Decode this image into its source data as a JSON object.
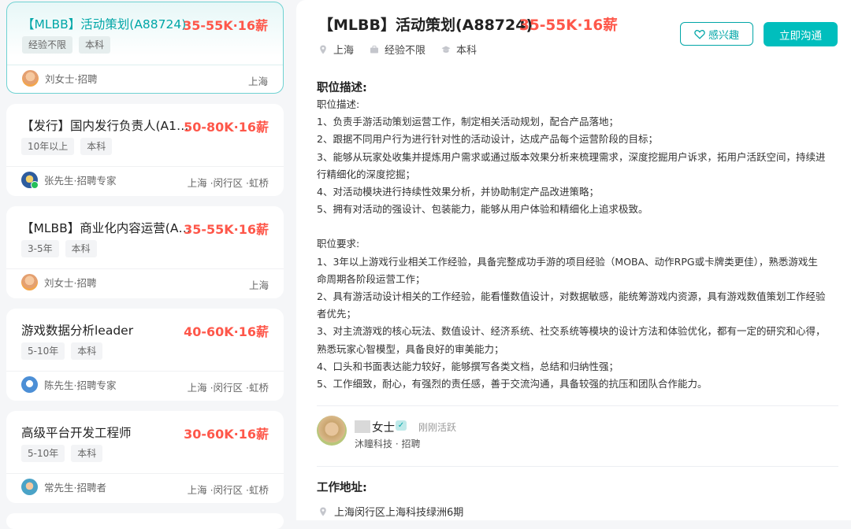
{
  "job_list": [
    {
      "title": "【MLBB】活动策划(A88724)",
      "salary": "35-55K·16薪",
      "tags": [
        "经验不限",
        "本科"
      ],
      "recruiter": "刘女士·招聘",
      "location": "上海"
    },
    {
      "title": "【发行】国内发行负责人(A114…",
      "salary": "50-80K·16薪",
      "tags": [
        "10年以上",
        "本科"
      ],
      "recruiter": "张先生·招聘专家",
      "location": "上海 ·闵行区 ·虹桥"
    },
    {
      "title": "【MLBB】商业化内容运营(A7…",
      "salary": "35-55K·16薪",
      "tags": [
        "3-5年",
        "本科"
      ],
      "recruiter": "刘女士·招聘",
      "location": "上海"
    },
    {
      "title": "游戏数据分析leader",
      "salary": "40-60K·16薪",
      "tags": [
        "5-10年",
        "本科"
      ],
      "recruiter": "陈先生·招聘专家",
      "location": "上海 ·闵行区 ·虹桥"
    },
    {
      "title": "高级平台开发工程师",
      "salary": "30-60K·16薪",
      "tags": [
        "5-10年",
        "本科"
      ],
      "recruiter": "常先生·招聘者",
      "location": "上海 ·闵行区 ·虹桥"
    }
  ],
  "detail": {
    "title": "【MLBB】活动策划(A88724)",
    "salary": "35-55K·16薪",
    "meta": {
      "city": "上海",
      "experience": "经验不限",
      "degree": "本科"
    },
    "btn_interest": "感兴趣",
    "btn_chat": "立即沟通",
    "desc_heading": "职位描述:",
    "desc_lines": [
      "职位描述:",
      "1、负责手游活动策划运营工作，制定相关活动规划，配合产品落地；",
      "2、跟据不同用户行为进行针对性的活动设计，达成产品每个运营阶段的目标；",
      "3、能够从玩家处收集并提炼用户需求或通过版本效果分析来梳理需求，深度挖掘用户诉求，拓用户活跃空间，持续进",
      "行精细化的深度挖掘；",
      "4、对活动模块进行持续性效果分析，并协助制定产品改进策略；",
      "5、拥有对活动的强设计、包装能力，能够从用户体验和精细化上追求极致。"
    ],
    "req_lines": [
      "职位要求:",
      "1、3年以上游戏行业相关工作经验，具备完整成功手游的项目经验（MOBA、动作RPG或卡牌类更佳），熟悉游戏生",
      "命周期各阶段运营工作；",
      "2、具有游活动设计相关的工作经验，能看懂数值设计，对数据敏感，能统筹游戏内资源，具有游戏数值策划工作经验",
      "者优先；",
      "3、对主流游戏的核心玩法、数值设计、经济系统、社交系统等模块的设计方法和体验优化，都有一定的研究和心得，",
      "熟悉玩家心智模型，具备良好的审美能力；",
      "4、口头和书面表达能力较好，能够撰写各类文档，总结和归纳性强；",
      "5、工作细致，耐心，有强烈的责任感，善于交流沟通，具备较强的抗压和团队合作能力。"
    ],
    "boss": {
      "name": "女士",
      "status": "刚刚活跃",
      "company": "沐瞳科技 · 招聘"
    },
    "address_heading": "工作地址:",
    "address": "上海闵行区上海科技绿洲6期"
  }
}
